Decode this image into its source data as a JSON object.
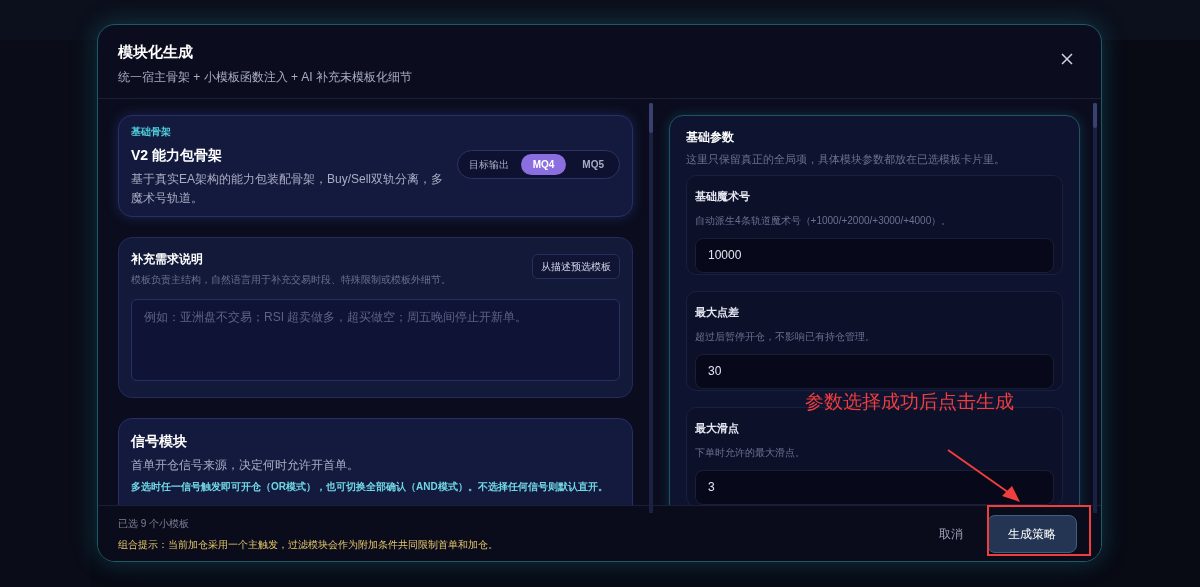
{
  "modal": {
    "title": "模块化生成",
    "subtitle": "统一宿主骨架 + 小模板函数注入 + AI 补充未模板化细节"
  },
  "skeleton_card": {
    "eyebrow": "基础骨架",
    "title": "V2 能力包骨架",
    "description": "基于真实EA架构的能力包装配骨架，Buy/Sell双轨分离，多魔术号轨道。",
    "output_label": "目标输出",
    "output_options": [
      {
        "label": "MQ4",
        "selected": true
      },
      {
        "label": "MQ5",
        "selected": false
      }
    ]
  },
  "requirements_card": {
    "title": "补充需求说明",
    "description": "模板负责主结构，自然语言用于补充交易时段、特殊限制或模板外细节。",
    "preset_button": "从描述预选模板",
    "textarea": {
      "placeholder": "例如：亚洲盘不交易；RSI 超卖做多，超买做空；周五晚间停止开新单。"
    }
  },
  "signal_card": {
    "title": "信号模块",
    "description": "首单开仓信号来源，决定何时允许开首单。",
    "note": "多选时任一信号触发即可开仓（OR模式），也可切换全部确认（AND模式）。不选择任何信号则默认直开。"
  },
  "params_panel": {
    "title": "基础参数",
    "description": "这里只保留真正的全局项，具体模块参数都放在已选模板卡片里。",
    "fields": [
      {
        "label": "基础魔术号",
        "hint": "自动派生4条轨道魔术号（+1000/+2000/+3000/+4000）。",
        "value": "10000"
      },
      {
        "label": "最大点差",
        "hint": "超过后暂停开仓，不影响已有持仓管理。",
        "value": "30"
      },
      {
        "label": "最大滑点",
        "hint": "下单时允许的最大滑点。",
        "value": "3"
      }
    ]
  },
  "footer": {
    "selected_count": "已选 9 个小模板",
    "hint": "组合提示：当前加仓采用一个主触发，过滤模块会作为附加条件共同限制首单和加仓。",
    "cancel": "取消",
    "generate": "生成策略"
  },
  "annotation": {
    "text": "参数选择成功后点击生成"
  }
}
